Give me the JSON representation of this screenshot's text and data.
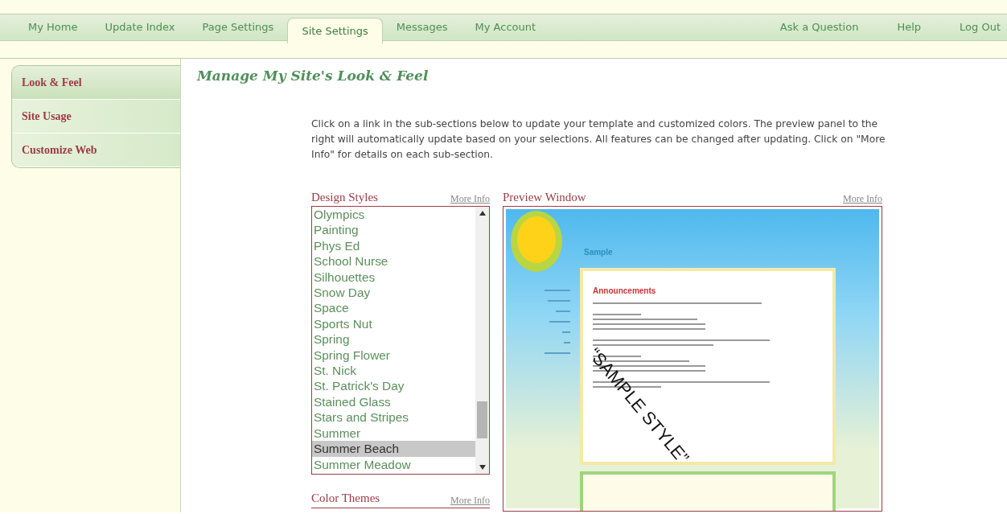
{
  "nav": {
    "tabs": [
      {
        "label": "My Home",
        "selected": false
      },
      {
        "label": "Update Index",
        "selected": false
      },
      {
        "label": "Page Settings",
        "selected": false
      },
      {
        "label": "Site Settings",
        "selected": true
      },
      {
        "label": "Messages",
        "selected": false
      },
      {
        "label": "My Account",
        "selected": false
      }
    ],
    "links": [
      "Ask a Question",
      "Help",
      "Log Out"
    ]
  },
  "sidebar": {
    "items": [
      {
        "label": "Look & Feel",
        "selected": true
      },
      {
        "label": "Site Usage",
        "selected": false
      },
      {
        "label": "Customize Web",
        "selected": false
      }
    ]
  },
  "title": "Manage My Site's Look & Feel",
  "intro": "Click on a link in the sub-sections below to update your template and customized colors. The preview panel to the right will automatically update based on your selections. All features can be changed after updating. Click on \"More Info\" for details on each sub-section.",
  "design_styles": {
    "title": "Design Styles",
    "more_info": "More Info",
    "items": [
      {
        "label": "Olympics",
        "selected": false
      },
      {
        "label": "Painting",
        "selected": false
      },
      {
        "label": "Phys Ed",
        "selected": false
      },
      {
        "label": "School Nurse",
        "selected": false
      },
      {
        "label": "Silhouettes",
        "selected": false
      },
      {
        "label": "Snow Day",
        "selected": false
      },
      {
        "label": "Space",
        "selected": false
      },
      {
        "label": "Sports Nut",
        "selected": false
      },
      {
        "label": "Spring",
        "selected": false
      },
      {
        "label": "Spring Flower",
        "selected": false
      },
      {
        "label": "St. Nick",
        "selected": false
      },
      {
        "label": "St. Patrick's Day",
        "selected": false
      },
      {
        "label": "Stained Glass",
        "selected": false
      },
      {
        "label": "Stars and Stripes",
        "selected": false
      },
      {
        "label": "Summer",
        "selected": false
      },
      {
        "label": "Summer Beach",
        "selected": true
      },
      {
        "label": "Summer Meadow",
        "selected": false
      }
    ]
  },
  "preview": {
    "title": "Preview Window",
    "more_info": "More Info",
    "site_title": "Sample",
    "heading": "Announcements",
    "overlay": "“SAMPLE STYLE”"
  },
  "color_themes": {
    "title": "Color Themes",
    "more_info": "More Info"
  }
}
